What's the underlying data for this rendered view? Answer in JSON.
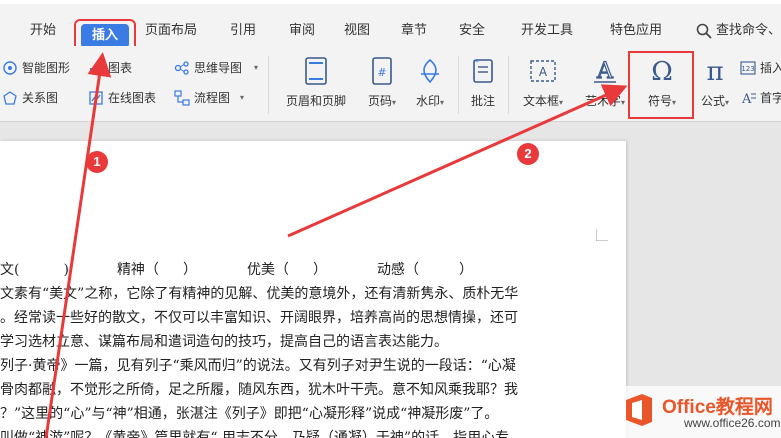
{
  "tabs": [
    {
      "label": "开始"
    },
    {
      "label": "插入"
    },
    {
      "label": "页面布局"
    },
    {
      "label": "引用"
    },
    {
      "label": "审阅"
    },
    {
      "label": "视图"
    },
    {
      "label": "章节"
    },
    {
      "label": "安全"
    },
    {
      "label": "开发工具"
    },
    {
      "label": "特色应用"
    }
  ],
  "search_label": "查找命令、",
  "ribbon": {
    "smart_art": "智能图形",
    "chart": "图表",
    "mind_map": "思维导图",
    "relation_map": "关系图",
    "online_chart": "在线图表",
    "flowchart": "流程图",
    "header_footer": "页眉和页脚",
    "page_number": "页码",
    "watermark": "水印",
    "comment": "批注",
    "textbox": "文本框",
    "wordart": "艺术字",
    "symbol": "符号",
    "formula": "公式",
    "insert_number": "插入",
    "first_letter": "首字"
  },
  "doc": {
    "line1": [
      "文(",
      ")",
      "精神（",
      "）",
      "优美（",
      "）",
      "动感（",
      "）"
    ],
    "line2": "文素有“美文”之称，它除了有精神的见解、优美的意境外，还有清新隽永、质朴无华",
    "line3": "。经常读一些好的散文，不仅可以丰富知识、开阔眼界，培养高尚的思想情操，还可",
    "line4": "学习选材立意、谋篇布局和遣词造句的技巧，提高自己的语言表达能力。",
    "line5": "列子·黄帝》一篇，见有列子“乘风而归”的说法。又有列子对尹生说的一段话：“心凝",
    "line6": "骨肉都融，不觉形之所倚，足之所履，随风东西，犹木叶干壳。意不知风乘我耶？我",
    "line7": "？”这里的“心”与“神”相通，张湛注《列子》即把“心凝形释”说成“神凝形废”了。",
    "line8": "叫做“神游”呢？《黄帝》篇里就有“ 用志不分，乃疑（通凝）于神”的话，指用心专"
  },
  "annotations": {
    "badge1": "1",
    "badge2": "2"
  },
  "watermark": {
    "brand": "Office教程网",
    "url": "www.office26.com"
  },
  "colors": {
    "accent": "#3a7be4",
    "highlight": "#e83a3a",
    "brand": "#e8562a"
  }
}
